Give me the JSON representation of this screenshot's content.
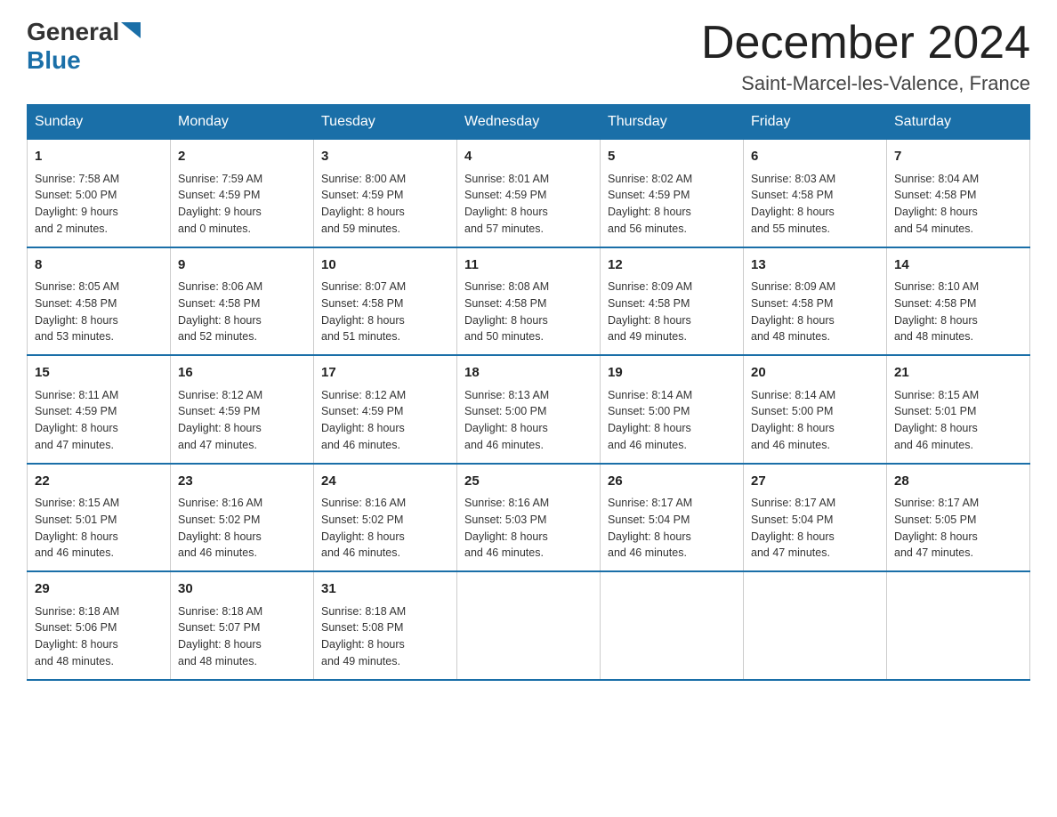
{
  "header": {
    "logo_general": "General",
    "logo_blue": "Blue",
    "month": "December 2024",
    "location": "Saint-Marcel-les-Valence, France"
  },
  "weekdays": [
    "Sunday",
    "Monday",
    "Tuesday",
    "Wednesday",
    "Thursday",
    "Friday",
    "Saturday"
  ],
  "weeks": [
    [
      {
        "day": "1",
        "sunrise": "7:58 AM",
        "sunset": "5:00 PM",
        "daylight": "9 hours and 2 minutes."
      },
      {
        "day": "2",
        "sunrise": "7:59 AM",
        "sunset": "4:59 PM",
        "daylight": "9 hours and 0 minutes."
      },
      {
        "day": "3",
        "sunrise": "8:00 AM",
        "sunset": "4:59 PM",
        "daylight": "8 hours and 59 minutes."
      },
      {
        "day": "4",
        "sunrise": "8:01 AM",
        "sunset": "4:59 PM",
        "daylight": "8 hours and 57 minutes."
      },
      {
        "day": "5",
        "sunrise": "8:02 AM",
        "sunset": "4:59 PM",
        "daylight": "8 hours and 56 minutes."
      },
      {
        "day": "6",
        "sunrise": "8:03 AM",
        "sunset": "4:58 PM",
        "daylight": "8 hours and 55 minutes."
      },
      {
        "day": "7",
        "sunrise": "8:04 AM",
        "sunset": "4:58 PM",
        "daylight": "8 hours and 54 minutes."
      }
    ],
    [
      {
        "day": "8",
        "sunrise": "8:05 AM",
        "sunset": "4:58 PM",
        "daylight": "8 hours and 53 minutes."
      },
      {
        "day": "9",
        "sunrise": "8:06 AM",
        "sunset": "4:58 PM",
        "daylight": "8 hours and 52 minutes."
      },
      {
        "day": "10",
        "sunrise": "8:07 AM",
        "sunset": "4:58 PM",
        "daylight": "8 hours and 51 minutes."
      },
      {
        "day": "11",
        "sunrise": "8:08 AM",
        "sunset": "4:58 PM",
        "daylight": "8 hours and 50 minutes."
      },
      {
        "day": "12",
        "sunrise": "8:09 AM",
        "sunset": "4:58 PM",
        "daylight": "8 hours and 49 minutes."
      },
      {
        "day": "13",
        "sunrise": "8:09 AM",
        "sunset": "4:58 PM",
        "daylight": "8 hours and 48 minutes."
      },
      {
        "day": "14",
        "sunrise": "8:10 AM",
        "sunset": "4:58 PM",
        "daylight": "8 hours and 48 minutes."
      }
    ],
    [
      {
        "day": "15",
        "sunrise": "8:11 AM",
        "sunset": "4:59 PM",
        "daylight": "8 hours and 47 minutes."
      },
      {
        "day": "16",
        "sunrise": "8:12 AM",
        "sunset": "4:59 PM",
        "daylight": "8 hours and 47 minutes."
      },
      {
        "day": "17",
        "sunrise": "8:12 AM",
        "sunset": "4:59 PM",
        "daylight": "8 hours and 46 minutes."
      },
      {
        "day": "18",
        "sunrise": "8:13 AM",
        "sunset": "5:00 PM",
        "daylight": "8 hours and 46 minutes."
      },
      {
        "day": "19",
        "sunrise": "8:14 AM",
        "sunset": "5:00 PM",
        "daylight": "8 hours and 46 minutes."
      },
      {
        "day": "20",
        "sunrise": "8:14 AM",
        "sunset": "5:00 PM",
        "daylight": "8 hours and 46 minutes."
      },
      {
        "day": "21",
        "sunrise": "8:15 AM",
        "sunset": "5:01 PM",
        "daylight": "8 hours and 46 minutes."
      }
    ],
    [
      {
        "day": "22",
        "sunrise": "8:15 AM",
        "sunset": "5:01 PM",
        "daylight": "8 hours and 46 minutes."
      },
      {
        "day": "23",
        "sunrise": "8:16 AM",
        "sunset": "5:02 PM",
        "daylight": "8 hours and 46 minutes."
      },
      {
        "day": "24",
        "sunrise": "8:16 AM",
        "sunset": "5:02 PM",
        "daylight": "8 hours and 46 minutes."
      },
      {
        "day": "25",
        "sunrise": "8:16 AM",
        "sunset": "5:03 PM",
        "daylight": "8 hours and 46 minutes."
      },
      {
        "day": "26",
        "sunrise": "8:17 AM",
        "sunset": "5:04 PM",
        "daylight": "8 hours and 46 minutes."
      },
      {
        "day": "27",
        "sunrise": "8:17 AM",
        "sunset": "5:04 PM",
        "daylight": "8 hours and 47 minutes."
      },
      {
        "day": "28",
        "sunrise": "8:17 AM",
        "sunset": "5:05 PM",
        "daylight": "8 hours and 47 minutes."
      }
    ],
    [
      {
        "day": "29",
        "sunrise": "8:18 AM",
        "sunset": "5:06 PM",
        "daylight": "8 hours and 48 minutes."
      },
      {
        "day": "30",
        "sunrise": "8:18 AM",
        "sunset": "5:07 PM",
        "daylight": "8 hours and 48 minutes."
      },
      {
        "day": "31",
        "sunrise": "8:18 AM",
        "sunset": "5:08 PM",
        "daylight": "8 hours and 49 minutes."
      },
      null,
      null,
      null,
      null
    ]
  ],
  "labels": {
    "sunrise": "Sunrise:",
    "sunset": "Sunset:",
    "daylight": "Daylight:"
  }
}
